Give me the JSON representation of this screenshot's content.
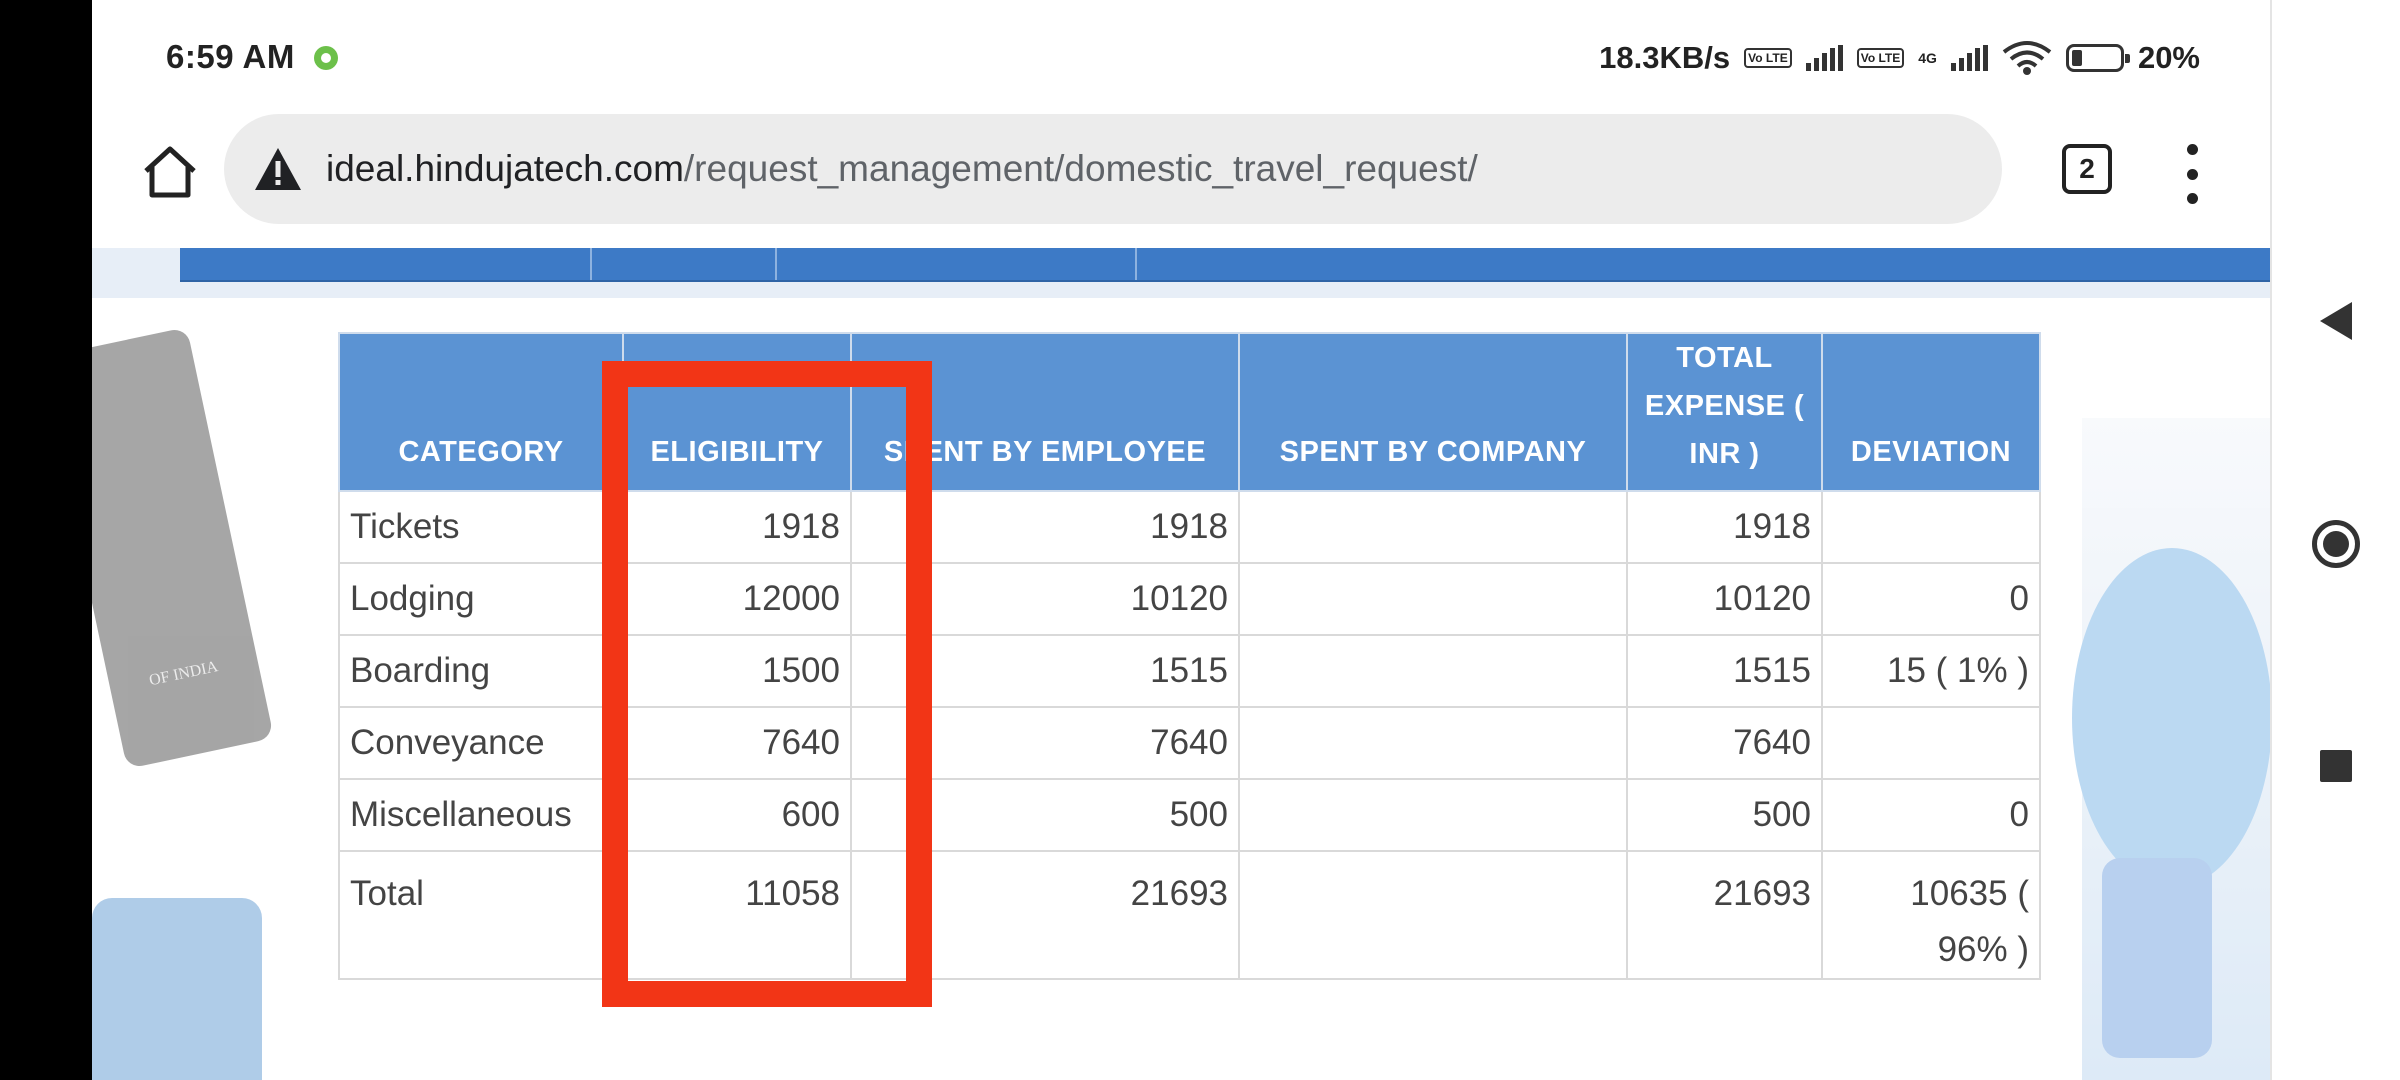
{
  "status_bar": {
    "time": "6:59 AM",
    "net_speed": "18.3KB/s",
    "volte_1": "Vo LTE",
    "volte_2": "Vo LTE",
    "network_type": "4G",
    "battery": "20%"
  },
  "browser": {
    "url_domain": "ideal.hindujatech.com",
    "url_path": "/request_management/domestic_travel_request/",
    "tab_count": "2"
  },
  "deco": {
    "passport_text": "OF INDIA"
  },
  "table": {
    "headers": [
      "CATEGORY",
      "ELIGIBILITY",
      "SPENT BY EMPLOYEE",
      "SPENT BY COMPANY",
      "TOTAL EXPENSE ( INR )",
      "DEVIATION"
    ],
    "rows": [
      [
        "Tickets",
        "1918",
        "1918",
        "",
        "1918",
        ""
      ],
      [
        "Lodging",
        "12000",
        "10120",
        "",
        "10120",
        "0"
      ],
      [
        "Boarding",
        "1500",
        "1515",
        "",
        "1515",
        "15 ( 1% )"
      ],
      [
        "Conveyance",
        "7640",
        "7640",
        "",
        "7640",
        ""
      ],
      [
        "Miscellaneous",
        "600",
        "500",
        "",
        "500",
        "0"
      ],
      [
        "Total",
        "11058",
        "21693",
        "",
        "21693",
        "10635 ( 96% )"
      ]
    ]
  },
  "colors": {
    "header_blue": "#5b93d3",
    "highlight_red": "#f23516"
  }
}
